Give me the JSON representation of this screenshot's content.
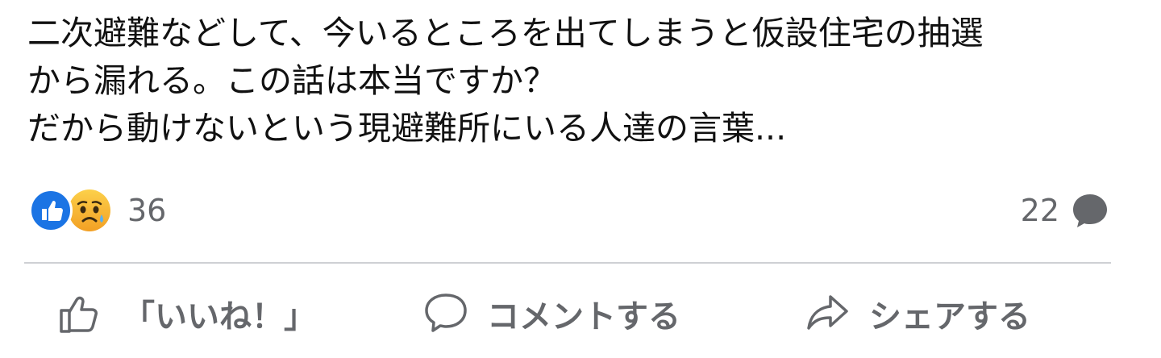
{
  "post": {
    "text_lines": [
      "二次避難などして、今いるところを出てしまうと仮設住宅の抽選",
      "から漏れる。この話は本当ですか？",
      "だから動けないという現避難所にいる人達の言葉..."
    ]
  },
  "reactions": {
    "icons": [
      "like-icon",
      "sad-face-icon"
    ],
    "count": "36"
  },
  "comments": {
    "count": "22",
    "icon": "comment-bubble-icon"
  },
  "actions": {
    "like_label": "「いいね！」",
    "comment_label": "コメントする",
    "share_label": "シェアする"
  },
  "colors": {
    "like_blue": "#1b74e4",
    "muted_text": "#65676b",
    "divider": "#ced0d4",
    "sad_yellow": "#f7b125"
  }
}
